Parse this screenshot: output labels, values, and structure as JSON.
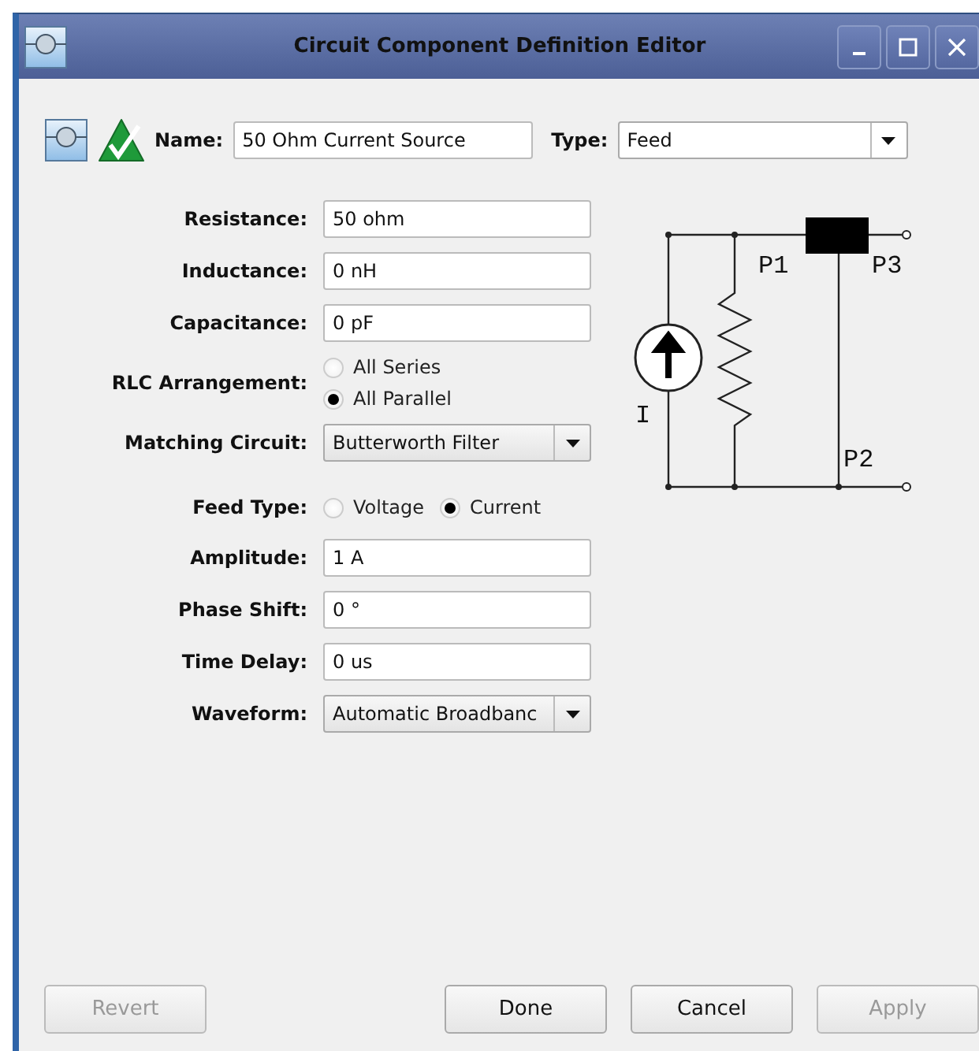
{
  "window": {
    "title": "Circuit Component Definition Editor"
  },
  "header": {
    "name_label": "Name:",
    "name_value": "50 Ohm Current Source",
    "type_label": "Type:",
    "type_value": "Feed"
  },
  "sections": [
    [
      {
        "kind": "text",
        "label": "Resistance:",
        "value": "50 ohm"
      },
      {
        "kind": "text",
        "label": "Inductance:",
        "value": "0 nH"
      },
      {
        "kind": "text",
        "label": "Capacitance:",
        "value": "0 pF"
      },
      {
        "kind": "radio-stack",
        "label": "RLC Arrangement:",
        "options": [
          {
            "label": "All Series",
            "selected": false
          },
          {
            "label": "All Parallel",
            "selected": true
          }
        ]
      },
      {
        "kind": "select",
        "label": "Matching Circuit:",
        "value": "Butterworth Filter"
      }
    ],
    [
      {
        "kind": "radio-row",
        "label": "Feed Type:",
        "options": [
          {
            "label": "Voltage",
            "selected": false
          },
          {
            "label": "Current",
            "selected": true
          }
        ]
      },
      {
        "kind": "text",
        "label": "Amplitude:",
        "value": "1 A"
      },
      {
        "kind": "text",
        "label": "Phase Shift:",
        "value": "0 °"
      },
      {
        "kind": "text",
        "label": "Time Delay:",
        "value": "0 us"
      },
      {
        "kind": "select",
        "label": "Waveform:",
        "value": "Automatic Broadbanc"
      }
    ]
  ],
  "diagram": {
    "labels": [
      "P1",
      "P3",
      "I",
      "P2"
    ]
  },
  "left_buttons": [
    {
      "label": "Revert",
      "disabled": true
    }
  ],
  "right_buttons": [
    {
      "label": "Done",
      "disabled": false
    },
    {
      "label": "Cancel",
      "disabled": false
    },
    {
      "label": "Apply",
      "disabled": true
    }
  ]
}
